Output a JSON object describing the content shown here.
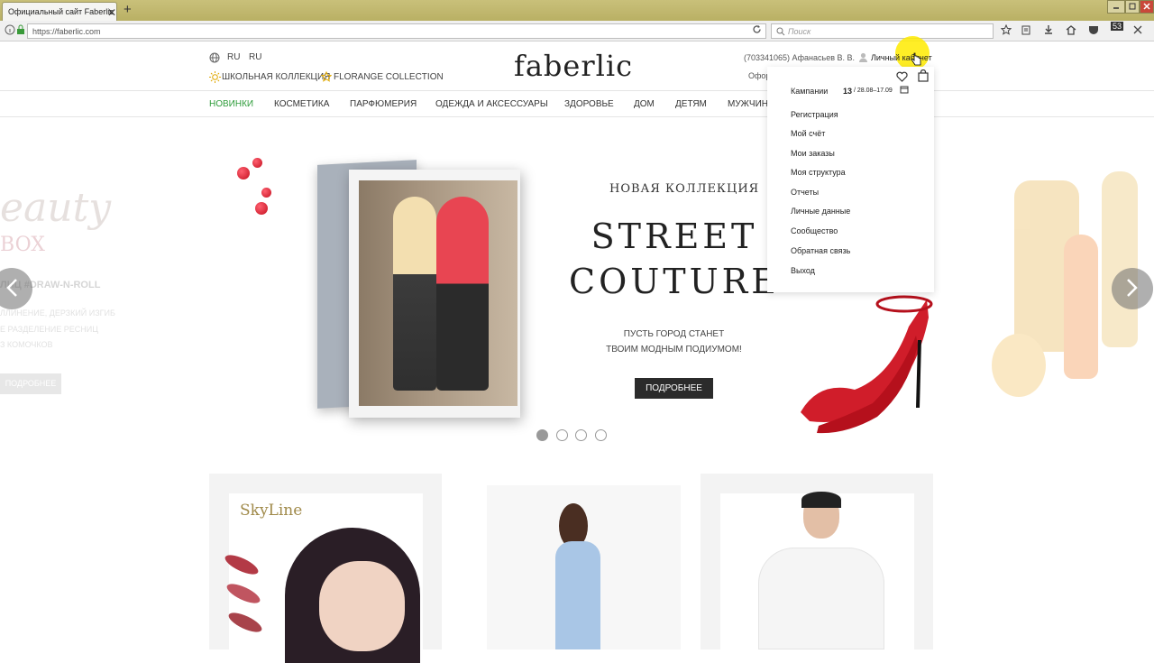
{
  "browser": {
    "tab_title": "Официальный сайт Faberlic",
    "tab_close": "✕",
    "new_tab": "+",
    "url": "https://faberlic.com",
    "search_placeholder": "Поиск",
    "badge": "53"
  },
  "header": {
    "lang1": "RU",
    "lang2": "RU",
    "promo1": "ШКОЛЬНАЯ КОЛЛЕКЦИЯ",
    "promo2": "FLORANGE COLLECTION",
    "logo": "faberlic",
    "user_id": "(703341065) Афанасьев В. В.",
    "cabinet": "Личный кабинет",
    "partial": "Офор"
  },
  "menu": [
    "НОВИНКИ",
    "КОСМЕТИКА",
    "ПАРФЮМЕРИЯ",
    "ОДЕЖДА И АКСЕССУАРЫ",
    "ЗДОРОВЬЕ",
    "ДОМ",
    "ДЕТЯМ",
    "МУЖЧИН"
  ],
  "dropdown": {
    "campaign_label": "Кампании",
    "campaign_num": "13",
    "campaign_dates": "/ 28.08–17.09",
    "items": [
      "Регистрация",
      "Мой счёт",
      "Мои заказы",
      "Моя структура",
      "Отчеты",
      "Личные данные",
      "Сообщество",
      "Обратная связь",
      "Выход"
    ]
  },
  "hero": {
    "kicker": "НОВАЯ КОЛЛЕКЦИЯ",
    "title1": "STREET",
    "title2": "COUTURE",
    "sub1": "ПУСТЬ ГОРОД СТАНЕТ",
    "sub2": "ТВОИМ МОДНЫМ ПОДИУМОМ!",
    "button": "ПОДРОБНЕЕ",
    "slides_total": 4,
    "slide_active": 1
  },
  "left_slide": {
    "script": "eauty",
    "box": "BOX",
    "tag": "ЛИЦ #DRAW-N-ROLL",
    "line1": "ЛЛИНЕНИЕ, ДЕРЗКИЙ ИЗГИБ",
    "line2": "Е РАЗДЕЛЕНИЕ РЕСНИЦ",
    "line3": "З КОМОЧКОВ",
    "button": "ПОДРОБНЕЕ"
  },
  "cards": {
    "card1_title": "SkyLine"
  },
  "colors": {
    "accent_green": "#2e9c3a",
    "hero_red": "#d01d2a",
    "button_dark": "#2b2b2b"
  }
}
